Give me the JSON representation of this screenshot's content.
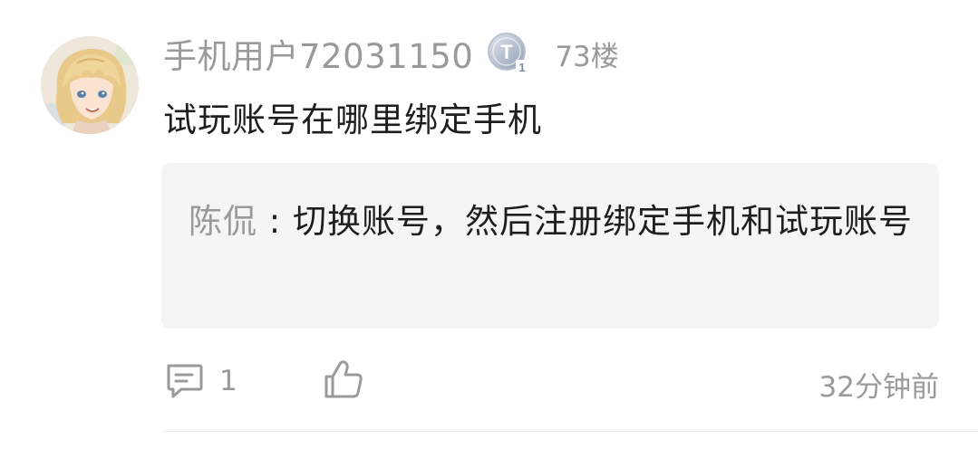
{
  "comment": {
    "username": "手机用户72031150",
    "level_badge_icon": "level-t1-badge",
    "floor": "73楼",
    "text": "试玩账号在哪里绑定手机"
  },
  "reply": {
    "author": "陈侃",
    "separator": " : ",
    "text": "切换账号，然后注册绑定手机和试玩账号"
  },
  "actions": {
    "comment_icon": "comment-bubble-icon",
    "comment_count": "1",
    "like_icon": "thumbs-up-icon",
    "timestamp": "32分钟前"
  },
  "colors": {
    "primary_text": "#1e1e1e",
    "secondary_text": "#9a9a9a",
    "reply_background": "#f5f5f5"
  }
}
